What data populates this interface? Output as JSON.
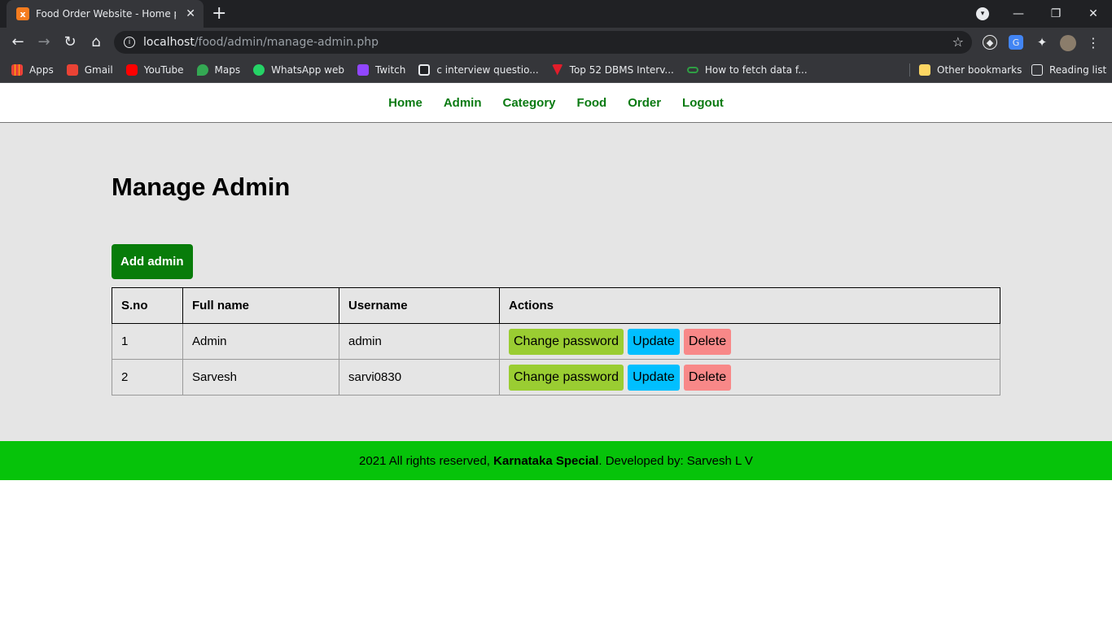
{
  "browser": {
    "tab_title": "Food Order Website - Home pag",
    "tab_favicon": "x",
    "url_host": "localhost",
    "url_path": "/food/admin/manage-admin.php",
    "bookmarks": [
      {
        "label": "Apps",
        "icon": "apps-grid-icon",
        "color": "#e8eaed"
      },
      {
        "label": "Gmail",
        "icon": "gmail-icon",
        "color": "#ea4335"
      },
      {
        "label": "YouTube",
        "icon": "youtube-icon",
        "color": "#ff0000"
      },
      {
        "label": "Maps",
        "icon": "maps-icon",
        "color": "#34a853"
      },
      {
        "label": "WhatsApp web",
        "icon": "whatsapp-icon",
        "color": "#25d366"
      },
      {
        "label": "Twitch",
        "icon": "twitch-icon",
        "color": "#9146ff"
      },
      {
        "label": "c interview questio...",
        "icon": "geeks-icon",
        "color": "#e8eaed"
      },
      {
        "label": "Top 52 DBMS Interv...",
        "icon": "bookmark-red-icon",
        "color": "#e11d2a"
      },
      {
        "label": "How to fetch data f...",
        "icon": "link-icon",
        "color": "#2f9e44"
      }
    ],
    "other_bookmarks": "Other bookmarks",
    "reading_list": "Reading list"
  },
  "nav": {
    "items": [
      "Home",
      "Admin",
      "Category",
      "Food",
      "Order",
      "Logout"
    ]
  },
  "main": {
    "title": "Manage Admin",
    "add_button": "Add admin",
    "table": {
      "headers": [
        "S.no",
        "Full name",
        "Username",
        "Actions"
      ],
      "rows": [
        {
          "sno": "1",
          "full_name": "Admin",
          "username": "admin"
        },
        {
          "sno": "2",
          "full_name": "Sarvesh",
          "username": "sarvi0830"
        }
      ],
      "actions": {
        "change_password": "Change password",
        "update": "Update",
        "delete": "Delete"
      }
    }
  },
  "footer": {
    "prefix": "2021 All rights reserved, ",
    "brand": "Karnataka Special",
    "suffix": ". Developed by: Sarvesh L V"
  },
  "colors": {
    "nav_link": "#0a7a12",
    "add_button": "#087c0a",
    "change_password": "#9acd32",
    "update": "#00bfff",
    "delete": "#f88888",
    "footer": "#06c30a",
    "main_bg": "#e5e5e5"
  }
}
